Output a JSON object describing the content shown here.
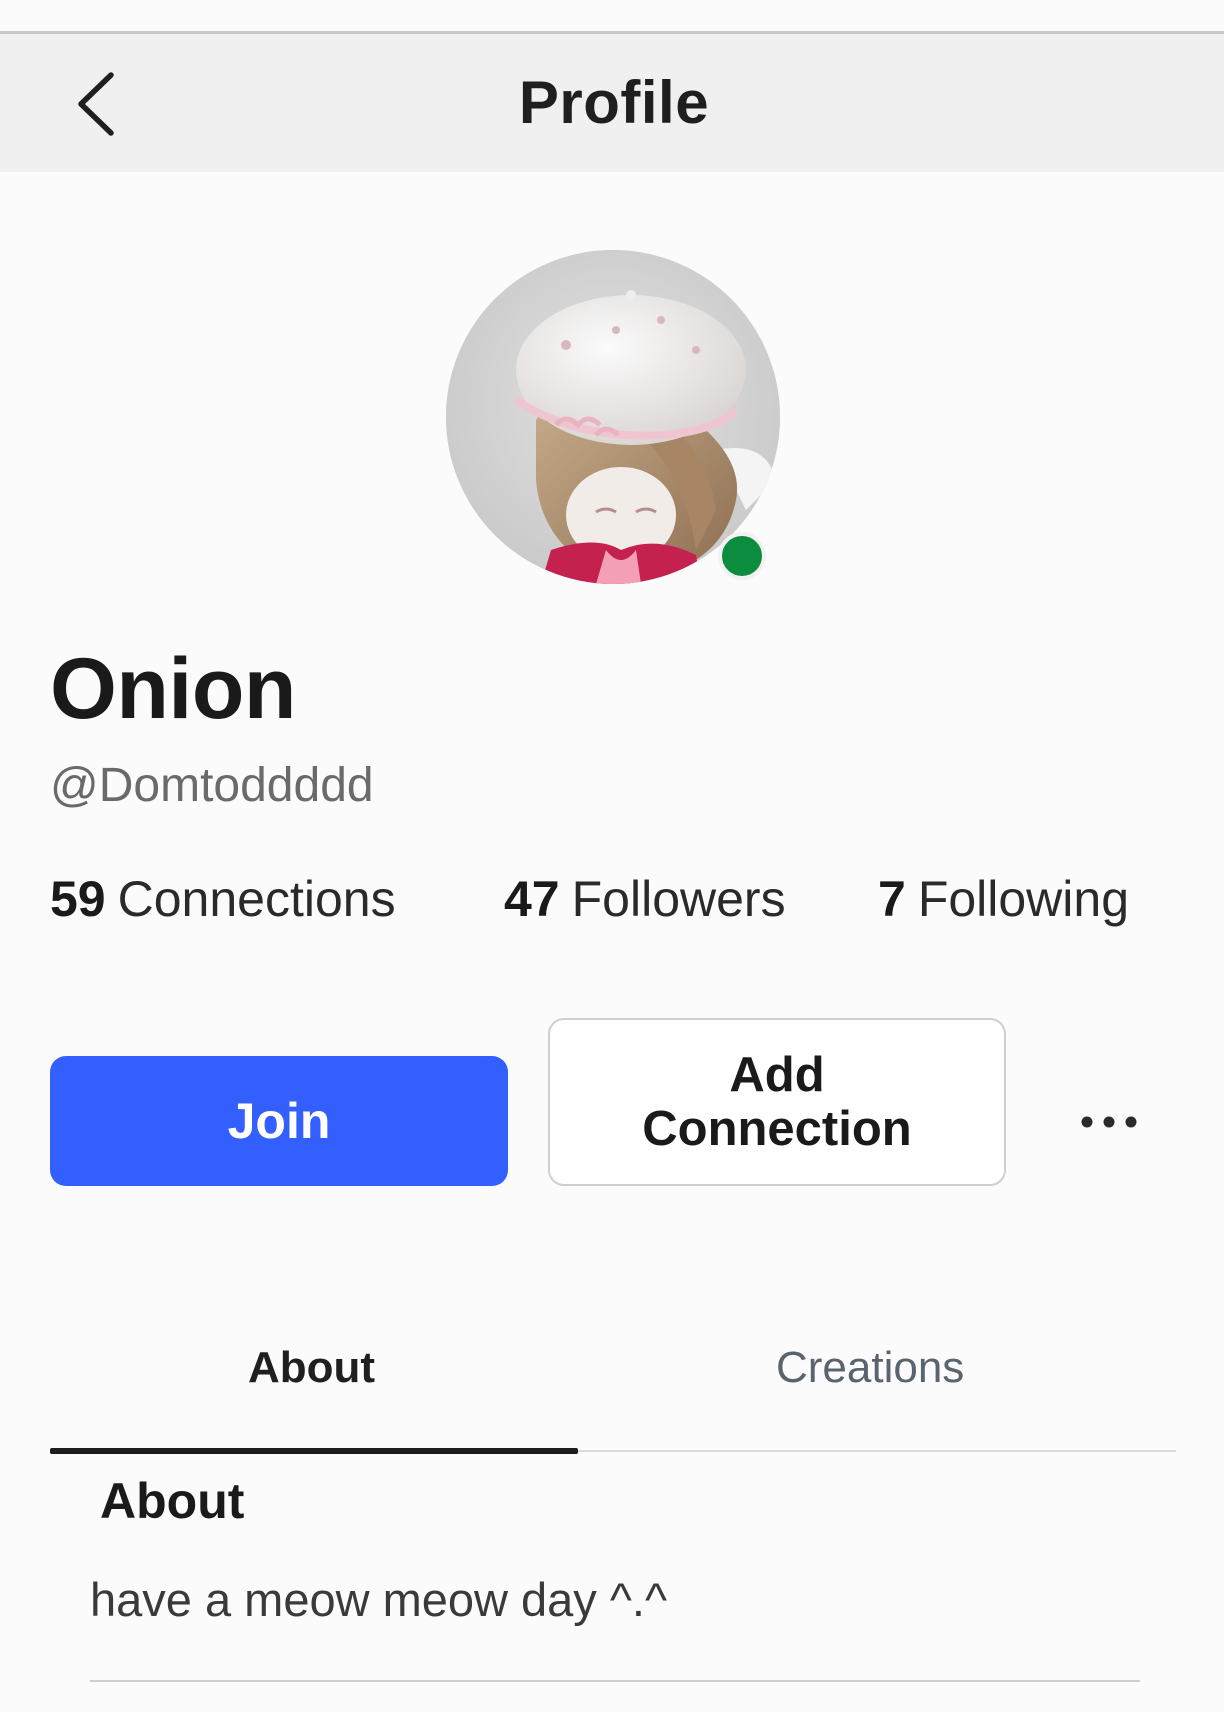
{
  "header": {
    "title": "Profile",
    "back_icon": "chevron-left-icon"
  },
  "profile": {
    "display_name": "Onion",
    "username": "@Domtoddddd",
    "online": true,
    "presence_color": "#0c8c3e"
  },
  "stats": {
    "connections": {
      "count": "59",
      "label": "Connections"
    },
    "followers": {
      "count": "47",
      "label": "Followers"
    },
    "following": {
      "count": "7",
      "label": "Following"
    }
  },
  "actions": {
    "join_label": "Join",
    "join_color": "#335fff",
    "add_connection_line1": "Add",
    "add_connection_line2": "Connection",
    "more_icon": "more-horizontal-icon"
  },
  "tabs": [
    {
      "label": "About",
      "active": true
    },
    {
      "label": "Creations",
      "active": false
    }
  ],
  "about": {
    "heading": "About",
    "text": "have a meow meow day ^.^"
  }
}
